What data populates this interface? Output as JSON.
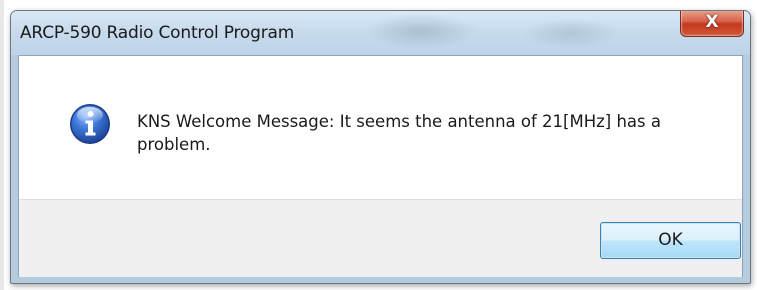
{
  "window": {
    "title": "ARCP-590 Radio Control Program",
    "close_label": "X"
  },
  "message": {
    "icon": "information-icon",
    "text": "KNS Welcome Message: It seems the antenna of 21[MHz] has a problem."
  },
  "buttons": {
    "ok_label": "OK"
  },
  "colors": {
    "titlebar": "#c9dcee",
    "close_button": "#c53a1e",
    "button_area": "#f0f0f0",
    "ok_button_border": "#3c7fb1",
    "info_icon": "#2b63c4"
  }
}
